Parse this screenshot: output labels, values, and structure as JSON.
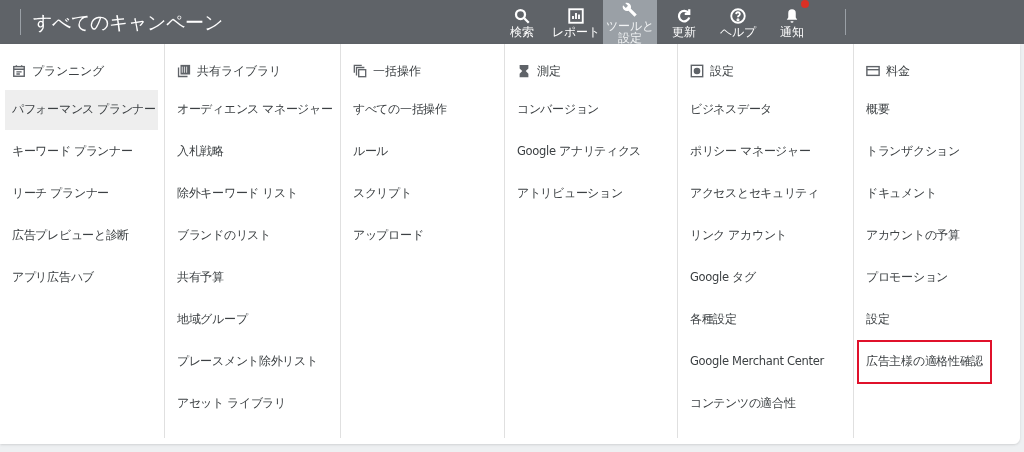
{
  "header": {
    "title": "すべてのキャンペーン",
    "nav": [
      {
        "label": "検索",
        "selected": false,
        "badge": false
      },
      {
        "label": "レポート",
        "selected": false,
        "badge": false
      },
      {
        "label": "ツールと設定",
        "selected": true,
        "badge": false
      },
      {
        "label": "更新",
        "selected": false,
        "badge": false
      },
      {
        "label": "ヘルプ",
        "selected": false,
        "badge": false
      },
      {
        "label": "通知",
        "selected": false,
        "badge": true
      }
    ]
  },
  "menu": {
    "columns": [
      {
        "heading": "プランニング",
        "items": [
          {
            "label": "パフォーマンス プランナー",
            "selected": true,
            "outlined": false
          },
          {
            "label": "キーワード プランナー",
            "selected": false,
            "outlined": false
          },
          {
            "label": "リーチ プランナー",
            "selected": false,
            "outlined": false
          },
          {
            "label": "広告プレビューと診断",
            "selected": false,
            "outlined": false
          },
          {
            "label": "アプリ広告ハブ",
            "selected": false,
            "outlined": false
          }
        ]
      },
      {
        "heading": "共有ライブラリ",
        "items": [
          {
            "label": "オーディエンス マネージャー",
            "selected": false,
            "outlined": false
          },
          {
            "label": "入札戦略",
            "selected": false,
            "outlined": false
          },
          {
            "label": "除外キーワード リスト",
            "selected": false,
            "outlined": false
          },
          {
            "label": "ブランドのリスト",
            "selected": false,
            "outlined": false
          },
          {
            "label": "共有予算",
            "selected": false,
            "outlined": false
          },
          {
            "label": "地域グループ",
            "selected": false,
            "outlined": false
          },
          {
            "label": "プレースメント除外リスト",
            "selected": false,
            "outlined": false
          },
          {
            "label": "アセット ライブラリ",
            "selected": false,
            "outlined": false
          }
        ]
      },
      {
        "heading": "一括操作",
        "items": [
          {
            "label": "すべての一括操作",
            "selected": false,
            "outlined": false
          },
          {
            "label": "ルール",
            "selected": false,
            "outlined": false
          },
          {
            "label": "スクリプト",
            "selected": false,
            "outlined": false
          },
          {
            "label": "アップロード",
            "selected": false,
            "outlined": false
          }
        ]
      },
      {
        "heading": "測定",
        "items": [
          {
            "label": "コンバージョン",
            "selected": false,
            "outlined": false
          },
          {
            "label": "Google アナリティクス",
            "selected": false,
            "outlined": false
          },
          {
            "label": "アトリビューション",
            "selected": false,
            "outlined": false
          }
        ]
      },
      {
        "heading": "設定",
        "items": [
          {
            "label": "ビジネスデータ",
            "selected": false,
            "outlined": false
          },
          {
            "label": "ポリシー マネージャー",
            "selected": false,
            "outlined": false
          },
          {
            "label": "アクセスとセキュリティ",
            "selected": false,
            "outlined": false
          },
          {
            "label": "リンク アカウント",
            "selected": false,
            "outlined": false
          },
          {
            "label": "Google タグ",
            "selected": false,
            "outlined": false
          },
          {
            "label": "各種設定",
            "selected": false,
            "outlined": false
          },
          {
            "label": "Google Merchant Center",
            "selected": false,
            "outlined": false
          },
          {
            "label": "コンテンツの適合性",
            "selected": false,
            "outlined": false
          }
        ]
      },
      {
        "heading": "料金",
        "items": [
          {
            "label": "概要",
            "selected": false,
            "outlined": false
          },
          {
            "label": "トランザクション",
            "selected": false,
            "outlined": false
          },
          {
            "label": "ドキュメント",
            "selected": false,
            "outlined": false
          },
          {
            "label": "アカウントの予算",
            "selected": false,
            "outlined": false
          },
          {
            "label": "プロモーション",
            "selected": false,
            "outlined": false
          },
          {
            "label": "設定",
            "selected": false,
            "outlined": false
          },
          {
            "label": "広告主様の適格性確認",
            "selected": false,
            "outlined": true
          }
        ]
      }
    ]
  }
}
